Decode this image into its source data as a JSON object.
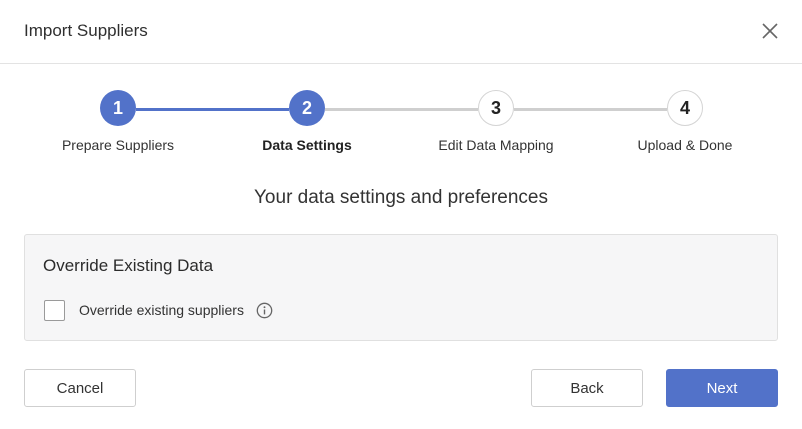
{
  "dialog": {
    "title": "Import Suppliers",
    "close_icon": "close-icon"
  },
  "stepper": {
    "current_step": 2,
    "active_color": "#5272c9",
    "steps": [
      {
        "number": "1",
        "label": "Prepare Suppliers",
        "state": "completed"
      },
      {
        "number": "2",
        "label": "Data Settings",
        "state": "current"
      },
      {
        "number": "3",
        "label": "Edit Data Mapping",
        "state": "upcoming"
      },
      {
        "number": "4",
        "label": "Upload & Done",
        "state": "upcoming"
      }
    ]
  },
  "main": {
    "subtitle": "Your data settings and preferences",
    "panel": {
      "title": "Override Existing Data",
      "checkbox_label": "Override existing suppliers",
      "checkbox_checked": false,
      "info_icon": "info-icon"
    }
  },
  "footer": {
    "cancel_label": "Cancel",
    "back_label": "Back",
    "next_label": "Next"
  }
}
